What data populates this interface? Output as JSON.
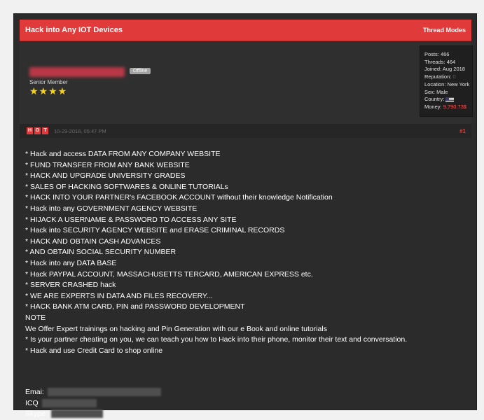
{
  "thread": {
    "title": "Hack into Any IOT Devices",
    "modes_label": "Thread Modes"
  },
  "user": {
    "status_badge": "Offline",
    "rank": "Senior Member",
    "stars": "★★★★"
  },
  "stats": {
    "posts_label": "Posts:",
    "posts": "466",
    "threads_label": "Threads:",
    "threads": "464",
    "joined_label": "Joined:",
    "joined": "Aug 2018",
    "reputation_label": "Reputation:",
    "reputation": "0",
    "location_label": "Location:",
    "location": "New York",
    "sex_label": "Sex:",
    "sex": "Male",
    "country_label": "Country:",
    "money_label": "Money:",
    "money": "9,790.73$"
  },
  "post": {
    "icon_letters": [
      "H",
      "O",
      "T"
    ],
    "date": "10-29-2018, 05:47 PM",
    "number": "#1",
    "lines": [
      "* Hack and access DATA FROM ANY COMPANY WEBSITE",
      "* FUND TRANSFER FROM ANY BANK WEBSITE",
      "* HACK AND UPGRADE UNIVERSITY GRADES",
      "* SALES OF HACKING SOFTWARES & ONLINE TUTORIALs",
      "* HACK INTO YOUR PARTNER's FACEBOOK ACCOUNT without their knowledge Notification",
      "* Hack into any GOVERNMENT AGENCY WEBSITE",
      "* HIJACK A USERNAME & PASSWORD TO ACCESS ANY SITE",
      "* Hack into SECURITY AGENCY WEBSITE and ERASE CRIMINAL RECORDS",
      "* HACK AND OBTAIN CASH ADVANCES",
      "* AND OBTAIN SOCIAL SECURITY NUMBER",
      "* Hack into any DATA BASE",
      "* Hack PAYPAL ACCOUNT, MASSACHUSETTS TERCARD, AMERICAN EXPRESS etc.",
      "* SERVER CRASHED hack",
      "* WE ARE EXPERTS IN DATA AND FILES RECOVERY...",
      "* HACK BANK ATM CARD, PIN and PASSWORD DEVELOPMENT",
      "NOTE",
      "We Offer Expert trainings on hacking and Pin Generation with our e Book and online tutorials",
      "* Is your partner cheating on you, we can teach you how to Hack into their phone, monitor their text and conversation.",
      "* Hack and use Credit Card to shop online"
    ],
    "contacts": {
      "email_label": "Emai:",
      "icq_label": "ICQ",
      "skype_label": "Skype:"
    }
  }
}
